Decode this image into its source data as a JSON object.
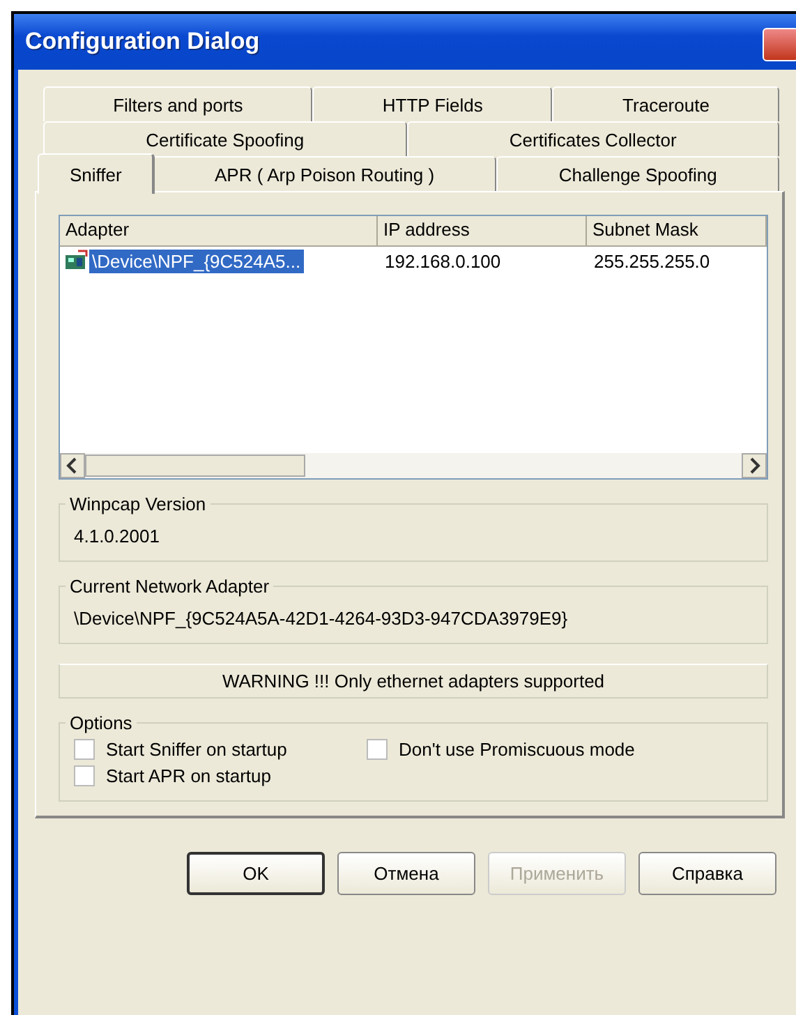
{
  "window": {
    "title": "Configuration Dialog"
  },
  "tab_rows": [
    [
      {
        "label": "Filters and ports",
        "selected": false
      },
      {
        "label": "HTTP Fields",
        "selected": false
      },
      {
        "label": "Traceroute",
        "selected": false
      }
    ],
    [
      {
        "label": "Certificate Spoofing",
        "selected": false
      },
      {
        "label": "Certificates Collector",
        "selected": false
      }
    ],
    [
      {
        "label": "Sniffer",
        "selected": true
      },
      {
        "label": "APR ( Arp Poison Routing )",
        "selected": false
      },
      {
        "label": "Challenge Spoofing",
        "selected": false
      }
    ]
  ],
  "adapter_table": {
    "columns": [
      "Adapter",
      "IP address",
      "Subnet Mask"
    ],
    "rows": [
      {
        "selected": true,
        "cells": [
          "\\Device\\NPF_{9C524A5...",
          "192.168.0.100",
          "255.255.255.0"
        ]
      }
    ]
  },
  "winpcap_version": {
    "label": "Winpcap Version",
    "value": "4.1.0.2001"
  },
  "current_adapter": {
    "label": "Current Network Adapter",
    "value": "\\Device\\NPF_{9C524A5A-42D1-4264-93D3-947CDA3979E9}"
  },
  "warning": "WARNING !!! Only ethernet adapters supported",
  "options": {
    "label": "Options",
    "items": [
      {
        "label": "Start Sniffer on startup",
        "checked": false
      },
      {
        "label": "Don't use Promiscuous mode",
        "checked": false
      },
      {
        "label": "Start APR on startup",
        "checked": false
      }
    ]
  },
  "buttons": [
    {
      "label": "OK",
      "default": true,
      "disabled": false
    },
    {
      "label": "Отмена",
      "default": false,
      "disabled": false
    },
    {
      "label": "Применить",
      "default": false,
      "disabled": true
    },
    {
      "label": "Справка",
      "default": false,
      "disabled": false
    }
  ]
}
